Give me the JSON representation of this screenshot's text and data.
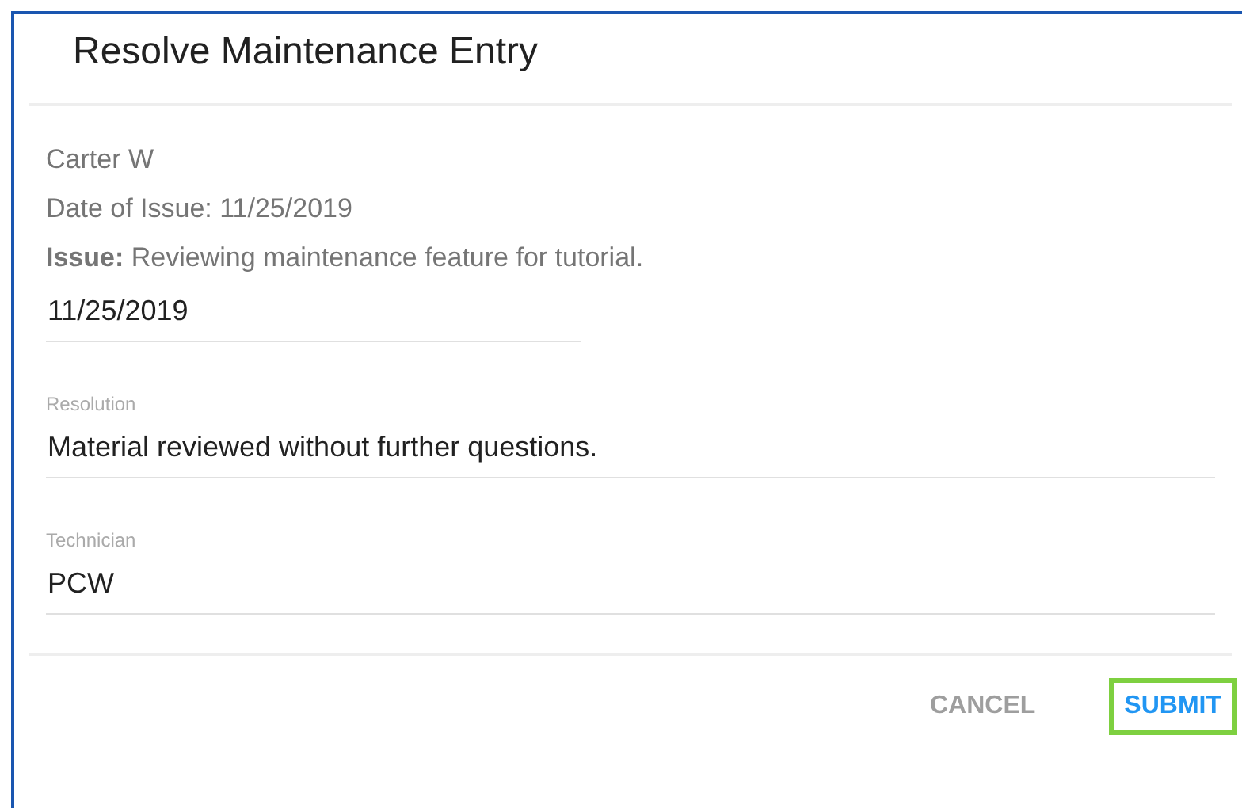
{
  "dialog": {
    "title": "Resolve Maintenance Entry"
  },
  "entry": {
    "reporter": "Carter W",
    "date_line": "Date of Issue: 11/25/2019",
    "issue": "**Issue:** Reviewing maintenance feature for tutorial."
  },
  "fields": [
    {
      "kind": "date",
      "value": "11/25/2019"
    },
    {
      "kind": "text",
      "label": "Resolution",
      "value": "Material reviewed without further questions."
    },
    {
      "kind": "text",
      "label": "Technician",
      "value": "PCW"
    }
  ],
  "buttons": [
    {
      "label": "CANCEL",
      "primary": false,
      "highlighted": false
    },
    {
      "label": "SUBMIT",
      "primary": true,
      "highlighted": true
    }
  ]
}
